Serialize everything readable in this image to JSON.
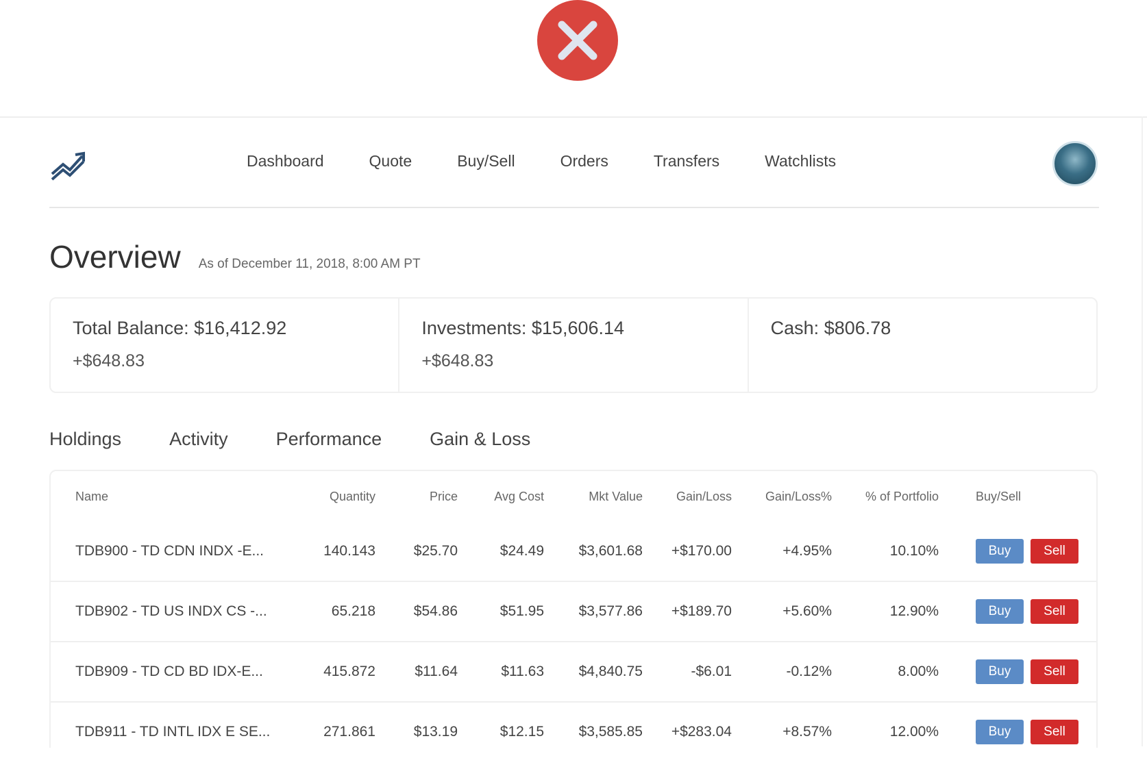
{
  "dialog": {
    "close_icon": "close-icon",
    "accent": "#d9453e"
  },
  "nav": {
    "logo_icon": "trending-up-icon",
    "links": [
      "Dashboard",
      "Quote",
      "Buy/Sell",
      "Orders",
      "Transfers",
      "Watchlists"
    ],
    "avatar": "user-avatar"
  },
  "overview": {
    "title": "Overview",
    "as_of": "As of December 11, 2018, 8:00 AM PT"
  },
  "balances": {
    "total": "Total Balance: $16,412.92",
    "total_change": "+$648.83",
    "investments": "Investments: $15,606.14",
    "investments_change": "+$648.83",
    "cash": "Cash: $806.78"
  },
  "tabs": [
    "Holdings",
    "Activity",
    "Performance",
    "Gain & Loss"
  ],
  "holdings": {
    "columns": [
      "Name",
      "Quantity",
      "Price",
      "Avg Cost",
      "Mkt Value",
      "Gain/Loss",
      "Gain/Loss%",
      "% of Portfolio",
      "Buy/Sell"
    ],
    "rows": [
      [
        "TDB900 - TD CDN INDX -E...",
        "140.143",
        "$25.70",
        "$24.49",
        "$3,601.68",
        "+$170.00",
        "+4.95%",
        "10.10%"
      ],
      [
        "TDB902 - TD US INDX CS -...",
        "65.218",
        "$54.86",
        "$51.95",
        "$3,577.86",
        "+$189.70",
        "+5.60%",
        "12.90%"
      ],
      [
        "TDB909 - TD CD BD IDX-E...",
        "415.872",
        "$11.64",
        "$11.63",
        "$4,840.75",
        "-$6.01",
        "-0.12%",
        "8.00%"
      ],
      [
        "TDB911 - TD INTL IDX E SE...",
        "271.861",
        "$13.19",
        "$12.15",
        "$3,585.85",
        "+$283.04",
        "+8.57%",
        "12.00%"
      ]
    ],
    "buy_label": "Buy",
    "sell_label": "Sell"
  },
  "colors": {
    "buy": "#5b8bc6",
    "sell": "#d22b2b",
    "close": "#d9453e"
  }
}
